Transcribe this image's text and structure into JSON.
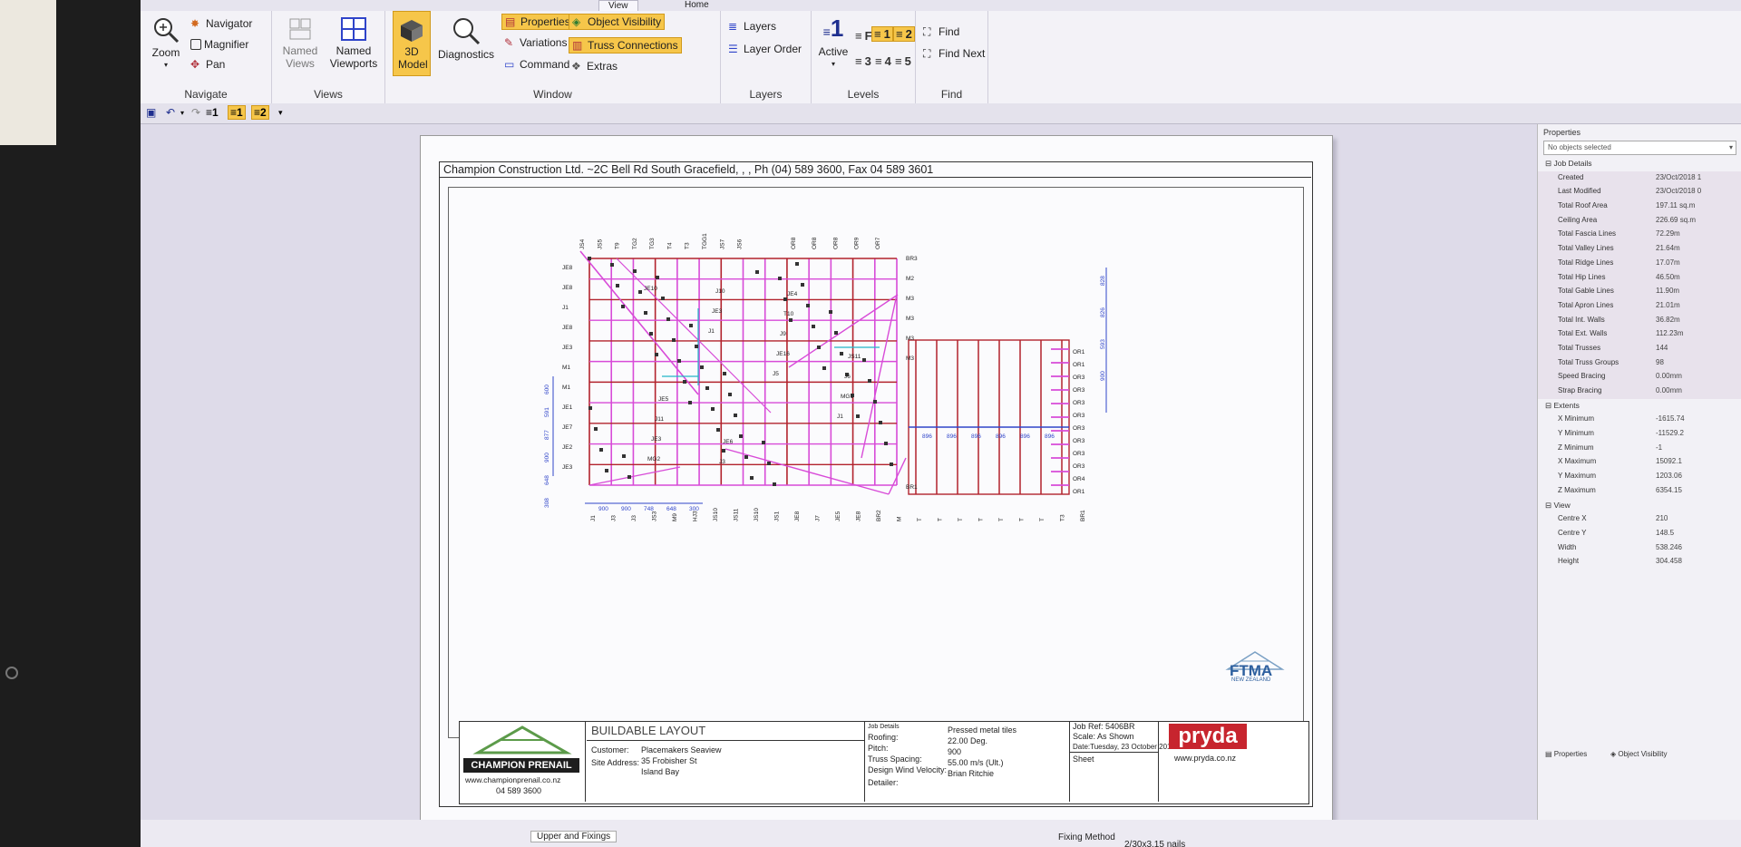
{
  "ribbon": {
    "tabs": [
      {
        "label": "View",
        "active": true
      },
      {
        "label": "Home",
        "active": false
      }
    ],
    "navigate": {
      "zoom": "Zoom",
      "navigator": "Navigator",
      "magnifier": "Magnifier",
      "pan": "Pan",
      "label": "Navigate"
    },
    "views": {
      "named_views": "Named Views",
      "named_viewports": "Named Viewports",
      "label": "Views"
    },
    "window": {
      "model_3d": "3D Model",
      "diagnostics": "Diagnostics",
      "properties": "Properties",
      "variations": "Variations",
      "command": "Command",
      "object_visibility": "Object Visibility",
      "truss_connections": "Truss Connections",
      "extras": "Extras",
      "label": "Window"
    },
    "layers": {
      "layers": "Layers",
      "layer_order": "Layer Order",
      "label": "Layers"
    },
    "levels": {
      "active": "Active",
      "active_number": "1",
      "levels": [
        "F",
        "1",
        "2",
        "3",
        "4",
        "5"
      ],
      "label": "Levels"
    },
    "find": {
      "find": "Find",
      "find_next": "Find Next",
      "label": "Find"
    }
  },
  "qat": {
    "levels": [
      "1",
      "1",
      "2"
    ]
  },
  "sheet": {
    "header": "Champion Construction Ltd. ~2C Bell Rd South Gracefield, , , Ph (04) 589 3600, Fax 04 589 3601",
    "plan_labels": {
      "top": [
        "JS4",
        "JS5",
        "T9",
        "TG2",
        "TG3",
        "T4",
        "T3",
        "TGG1",
        "JS7",
        "JS6",
        "OR8",
        "OR8",
        "OR8",
        "OR9",
        "OR7"
      ],
      "left": [
        "JE8",
        "JE8",
        "J1",
        "JE8",
        "JE3",
        "M1",
        "M1",
        "JE1",
        "JE7",
        "JE2",
        "JE3"
      ],
      "right": [
        "BR3",
        "M2",
        "M3",
        "M3",
        "M3",
        "M3",
        "BR1"
      ],
      "orl": [
        "OR1",
        "OR1",
        "OR3",
        "OR3",
        "OR3",
        "OR3",
        "OR3",
        "OR3",
        "OR3",
        "OR3",
        "OR4",
        "OR1"
      ],
      "bottom": [
        "J1",
        "J3",
        "J3",
        "JS3",
        "M9",
        "HJ3",
        "JS10",
        "JS11",
        "JS10",
        "JS1",
        "JE8",
        "J7",
        "JE5",
        "JE8",
        "BR2",
        "M",
        "T",
        "T",
        "T",
        "T",
        "T",
        "T",
        "T",
        "T3",
        "BR1"
      ],
      "interior": [
        "JE10",
        "J1",
        "J5",
        "J1",
        "MG2",
        "JE3",
        "JE16",
        "MG1",
        "JE3",
        "J10",
        "J9",
        "J6",
        "J11",
        "J3",
        "T10",
        "JS11",
        "JE5",
        "JE6",
        "JE4"
      ],
      "dims_v": [
        "600",
        "591",
        "877",
        "900",
        "648",
        "308",
        "828",
        "826",
        "593",
        "900"
      ],
      "dims_h": [
        "900",
        "900",
        "748",
        "648",
        "300",
        "896",
        "896",
        "896",
        "896",
        "896",
        "896"
      ]
    },
    "ftma": {
      "text": "FTMA",
      "sub": "NEW ZEALAND"
    },
    "titleblock": {
      "company": "CHAMPION PRENAIL",
      "website": "www.championprenail.co.nz",
      "phone": "04 589 3600",
      "title": "BUILDABLE LAYOUT",
      "customer_label": "Customer:",
      "customer": "Placemakers Seaview",
      "site_label": "Site Address:",
      "site_line1": "35 Frobisher St",
      "site_line2": "Island Bay",
      "job_details_label": "Job Details",
      "roofing_label": "Roofing:",
      "roofing": "Pressed metal tiles",
      "pitch_label": "Pitch:",
      "pitch": "22.00 Deg.",
      "spacing_label": "Truss Spacing:",
      "spacing": "900",
      "wind_label": "Design Wind Velocity:",
      "wind": "55.00 m/s (Ult.)",
      "detailer_label": "Detailer:",
      "detailer": "Brian Ritchie",
      "job_ref": "Job Ref: 5406BR",
      "scale": "Scale: As Shown",
      "date": "Date:Tuesday, 23 October 2018",
      "sheet": "Sheet",
      "pryda": "pryda",
      "pryda_web": "www.pryda.co.nz"
    }
  },
  "properties": {
    "title": "Properties",
    "select": "No objects selected",
    "sections": [
      {
        "name": "Job Details",
        "rows": [
          {
            "k": "Created",
            "v": "23/Oct/2018 1"
          },
          {
            "k": "Last Modified",
            "v": "23/Oct/2018 0"
          },
          {
            "k": "Total Roof Area",
            "v": "197.11 sq.m"
          },
          {
            "k": "Ceiling Area",
            "v": "226.69 sq.m"
          },
          {
            "k": "Total Fascia Lines",
            "v": "72.29m"
          },
          {
            "k": "Total Valley Lines",
            "v": "21.64m"
          },
          {
            "k": "Total Ridge Lines",
            "v": "17.07m"
          },
          {
            "k": "Total Hip Lines",
            "v": "46.50m"
          },
          {
            "k": "Total Gable Lines",
            "v": "11.90m"
          },
          {
            "k": "Total Apron Lines",
            "v": "21.01m"
          },
          {
            "k": "Total Int. Walls",
            "v": "36.82m"
          },
          {
            "k": "Total Ext. Walls",
            "v": "112.23m"
          },
          {
            "k": "Total Trusses",
            "v": "144"
          },
          {
            "k": "Total Truss Groups",
            "v": "98"
          },
          {
            "k": "Speed Bracing",
            "v": "0.00mm"
          },
          {
            "k": "Strap Bracing",
            "v": "0.00mm"
          }
        ]
      },
      {
        "name": "Extents",
        "rows": [
          {
            "k": "X Minimum",
            "v": "-1615.74"
          },
          {
            "k": "Y Minimum",
            "v": "-11529.2"
          },
          {
            "k": "Z Minimum",
            "v": "-1"
          },
          {
            "k": "X Maximum",
            "v": "15092.1"
          },
          {
            "k": "Y Maximum",
            "v": "1203.06"
          },
          {
            "k": "Z Maximum",
            "v": "6354.15"
          }
        ]
      },
      {
        "name": "View",
        "rows": [
          {
            "k": "Centre X",
            "v": "210"
          },
          {
            "k": "Centre Y",
            "v": "148.5"
          },
          {
            "k": "Width",
            "v": "538.246"
          },
          {
            "k": "Height",
            "v": "304.458"
          }
        ]
      }
    ],
    "tab_properties": "Properties",
    "tab_object_visibility": "Object Visibility"
  },
  "bottom": {
    "tab1": "Upper and Fixings",
    "fixing_method": "Fixing Method",
    "nails": "2/30x3.15 nails"
  },
  "colors": {
    "magenta": "#d84bd8",
    "red": "#b2232d",
    "blue": "#2f44c9",
    "cyan": "#22b7c9",
    "highlight": "#f6c64a"
  }
}
